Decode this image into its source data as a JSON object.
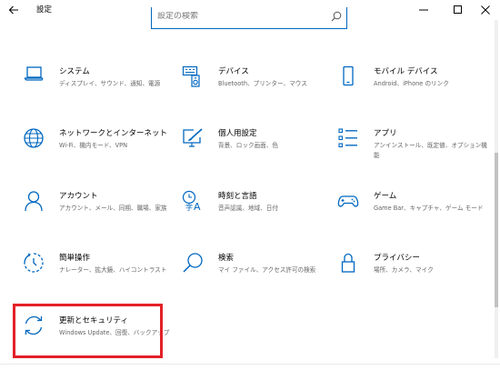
{
  "window": {
    "title": "設定"
  },
  "search": {
    "placeholder": "設定の検索"
  },
  "tiles": [
    {
      "title": "システム",
      "desc": "ディスプレイ、サウンド、通知、電源",
      "icon": "laptop-icon"
    },
    {
      "title": "デバイス",
      "desc": "Bluetooth、プリンター、マウス",
      "icon": "keyboard-speaker-icon"
    },
    {
      "title": "モバイル デバイス",
      "desc": "Android、iPhone のリンク",
      "icon": "phone-icon"
    },
    {
      "title": "ネットワークとインターネット",
      "desc": "Wi-Fi、機内モード、VPN",
      "icon": "globe-icon"
    },
    {
      "title": "個人用設定",
      "desc": "背景、ロック画面、色",
      "icon": "paintbrush-monitor-icon"
    },
    {
      "title": "アプリ",
      "desc": "アンインストール、既定値、オプション機能",
      "icon": "apps-list-icon"
    },
    {
      "title": "アカウント",
      "desc": "アカウント、メール、同期、職場、家族",
      "icon": "person-icon"
    },
    {
      "title": "時刻と言語",
      "desc": "音声認識、地域、日付",
      "icon": "time-language-icon"
    },
    {
      "title": "ゲーム",
      "desc": "Game Bar、キャプチャ、ゲーム モード",
      "icon": "gamepad-icon"
    },
    {
      "title": "簡単操作",
      "desc": "ナレーター、拡大鏡、ハイコントラスト",
      "icon": "ease-of-access-icon"
    },
    {
      "title": "検索",
      "desc": "マイ ファイル、アクセス許可の検索",
      "icon": "search-icon"
    },
    {
      "title": "プライバシー",
      "desc": "場所、カメラ、マイク",
      "icon": "lock-icon"
    },
    {
      "title": "更新とセキュリティ",
      "desc": "Windows Update、回復、バックアップ",
      "icon": "sync-icon"
    }
  ],
  "colors": {
    "accent": "#0067c0",
    "highlight": "#e32027"
  }
}
